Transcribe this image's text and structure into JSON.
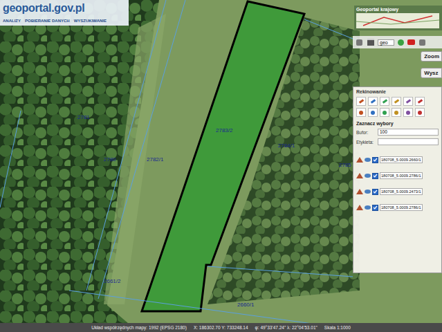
{
  "header": {
    "logo": "geoportal.gov.pl",
    "menu": [
      "ANALIZY",
      "POBIERANIE DANYCH",
      "WYSZUKIWANIE"
    ]
  },
  "overview": {
    "title": "Geoportal krajowy"
  },
  "toolbar": {
    "select": "geo"
  },
  "side_buttons": [
    "Zoom",
    "Wysz"
  ],
  "parcel_labels": [
    "2781",
    "2780",
    "2782/1",
    "2783/2",
    "2784/1",
    "2785",
    "2661/2",
    "2660/1"
  ],
  "panel": {
    "title": "Rekinowanie",
    "subtitle": "Zaznacz wybory",
    "fields": [
      {
        "label": "Bufor:",
        "value": "100"
      },
      {
        "label": "Etykieta:",
        "value": ""
      }
    ],
    "layers": [
      {
        "name": "180708_5.0009.2660/1",
        "checked": true
      },
      {
        "name": "180708_5.0009.2786/1",
        "checked": true
      },
      {
        "name": "180708_5.0009.2473/1",
        "checked": true
      },
      {
        "name": "180708_5.0009.2786/1",
        "checked": true
      }
    ]
  },
  "status_bar": [
    "Układ współrzędnych mapy: 1992 (EPSG 2180)",
    "X: 186302.70 Y: 733248.14",
    "φ: 49°33'47.24\" λ: 22°04'53.01\"",
    "Skala 1:1000"
  ]
}
